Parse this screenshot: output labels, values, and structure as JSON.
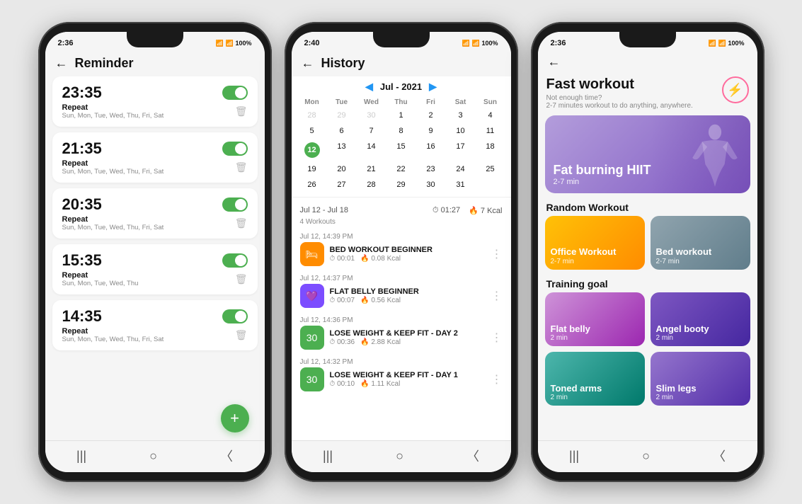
{
  "phone1": {
    "status": {
      "time": "2:36",
      "icons": "📶 100%"
    },
    "title": "Reminder",
    "reminders": [
      {
        "time": "23:35",
        "label": "Repeat",
        "days": "Sun, Mon, Tue, Wed, Thu, Fri, Sat",
        "enabled": true
      },
      {
        "time": "21:35",
        "label": "Repeat",
        "days": "Sun, Mon, Tue, Wed, Thu, Fri, Sat",
        "enabled": true
      },
      {
        "time": "20:35",
        "label": "Repeat",
        "days": "Sun, Mon, Tue, Wed, Thu, Fri, Sat",
        "enabled": true
      },
      {
        "time": "15:35",
        "label": "Repeat",
        "days": "Sun, Mon, Tue, Wed, Thu",
        "enabled": true
      },
      {
        "time": "14:35",
        "label": "Repeat",
        "days": "Sun, Mon, Tue, Wed, Thu, Fri, Sat",
        "enabled": true
      }
    ],
    "fab_label": "+"
  },
  "phone2": {
    "status": {
      "time": "2:40",
      "icons": "📶 100%"
    },
    "title": "History",
    "calendar": {
      "month": "Jul - 2021",
      "days_of_week": [
        "Mon",
        "Tue",
        "Wed",
        "Thu",
        "Fri",
        "Sat",
        "Sun"
      ],
      "weeks": [
        [
          "28",
          "29",
          "30",
          "1",
          "2",
          "3",
          "4"
        ],
        [
          "5",
          "6",
          "7",
          "8",
          "9",
          "10",
          "11"
        ],
        [
          "12",
          "13",
          "14",
          "15",
          "16",
          "17",
          "18"
        ],
        [
          "19",
          "20",
          "21",
          "22",
          "23",
          "24",
          "25"
        ],
        [
          "26",
          "27",
          "28",
          "29",
          "30",
          "31",
          ""
        ]
      ],
      "today": "12",
      "other_month_cols_week1": [
        0,
        1,
        2
      ]
    },
    "week_range": "Jul 12 - Jul 18",
    "workouts_count": "4 Workouts",
    "week_stats": {
      "time": "01:27",
      "kcal": "7 Kcal"
    },
    "entries": [
      {
        "date": "Jul 12, 14:39 PM",
        "title": "BED WORKOUT BEGINNER",
        "time": "00:01",
        "kcal": "0.08 Kcal",
        "color": "orange",
        "icon": "🛏"
      },
      {
        "date": "Jul 12, 14:37 PM",
        "title": "FLAT BELLY BEGINNER",
        "time": "00:07",
        "kcal": "0.56 Kcal",
        "color": "purple",
        "icon": "💜"
      },
      {
        "date": "Jul 12, 14:36 PM",
        "title": "LOSE WEIGHT & KEEP FIT - DAY 2",
        "time": "00:36",
        "kcal": "2.88 Kcal",
        "color": "green",
        "icon": "30"
      },
      {
        "date": "Jul 12, 14:32 PM",
        "title": "LOSE WEIGHT & KEEP FIT - DAY 1",
        "time": "00:10",
        "kcal": "1.11 Kcal",
        "color": "green",
        "icon": "30"
      }
    ]
  },
  "phone3": {
    "status": {
      "time": "2:36",
      "icons": "📶 100%"
    },
    "title": "Fast workout",
    "subtitle_line1": "Not enough time?",
    "subtitle_line2": "2-7 minutes workout to do anything, anywhere.",
    "hero": {
      "title": "Fat burning HIIT",
      "duration": "2-7 min"
    },
    "random_workout_label": "Random Workout",
    "random_workouts": [
      {
        "title": "Office Workout",
        "duration": "2-7 min",
        "style": "amber"
      },
      {
        "title": "Bed workout",
        "duration": "2-7 min",
        "style": "photo"
      }
    ],
    "training_goal_label": "Training goal",
    "training_goals": [
      {
        "title": "Flat belly",
        "duration": "2 min",
        "style": "purple-light"
      },
      {
        "title": "Angel booty",
        "duration": "2 min",
        "style": "purple-dark"
      },
      {
        "title": "Toned arms",
        "duration": "2 min",
        "style": "teal"
      },
      {
        "title": "Slim legs",
        "duration": "2 min",
        "style": "indigo"
      }
    ]
  }
}
